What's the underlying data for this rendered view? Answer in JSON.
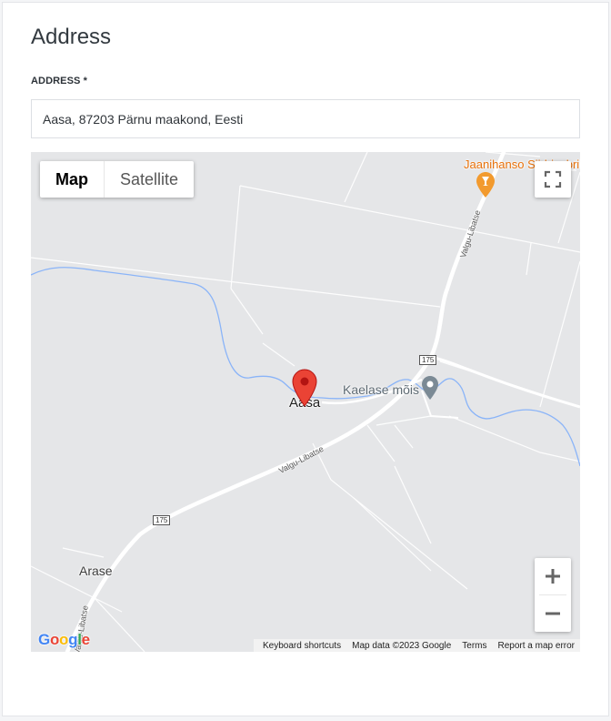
{
  "section": {
    "title": "Address"
  },
  "address_field": {
    "label": "ADDRESS *",
    "value": "Aasa, 87203 Pärnu maakond, Eesti"
  },
  "map": {
    "map_type_options": [
      "Map",
      "Satellite"
    ],
    "selected_map_type": "Map",
    "place_labels": {
      "aasa": "Aasa",
      "arase": "Arase",
      "kaelase": "Kaelase mõis",
      "jaanihanso": "Jaanihanso Siidrivabrik"
    },
    "road_numbers": {
      "r1": "175",
      "r2": "175"
    },
    "road_names": {
      "n1": "Valgu-Libatse",
      "n2": "Valgu-Libatse",
      "n3": "Valgu-Libatse"
    },
    "attribution": {
      "keyboard": "Keyboard shortcuts",
      "data": "Map data ©2023 Google",
      "terms": "Terms",
      "report": "Report a map error"
    },
    "logo": "Google",
    "icons": [
      "fullscreen-icon",
      "zoom-in-icon",
      "zoom-out-icon",
      "map-pin-icon",
      "poi-icon",
      "drink-poi-icon"
    ],
    "colors": {
      "pin": "#ea4335",
      "poi_orange": "#f29a2e",
      "poi_gray": "#7b8a95",
      "water": "#8ab4f8",
      "road": "#ffffff"
    }
  }
}
